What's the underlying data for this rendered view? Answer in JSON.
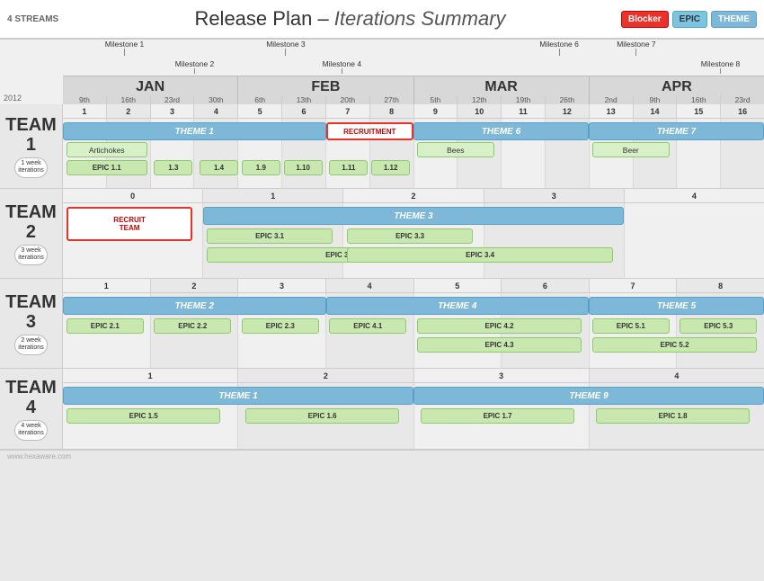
{
  "header": {
    "streams": "4 STREAMS",
    "title": "Release Plan",
    "subtitle": "Iterations Summary",
    "badges": {
      "blocker": "Blocker",
      "epic": "EPIC",
      "theme": "THEME"
    }
  },
  "year": "2012",
  "milestones_top": [
    {
      "label": "Milestone 1",
      "left_pct": 9
    },
    {
      "label": "Milestone 3",
      "left_pct": 31
    },
    {
      "label": "Milestone 6",
      "left_pct": 70
    },
    {
      "label": "Milestone 7",
      "left_pct": 79
    }
  ],
  "milestones_mid": [
    {
      "label": "Milestone 2",
      "left_pct": 18
    },
    {
      "label": "Milestone 4",
      "left_pct": 39
    },
    {
      "label": "Milestone 8",
      "left_pct": 92
    }
  ],
  "months": [
    {
      "name": "JAN",
      "days": [
        "9th",
        "16th",
        "23rd",
        "30th"
      ],
      "width_pct": 25
    },
    {
      "name": "FEB",
      "days": [
        "6th",
        "13th",
        "20th",
        "27th"
      ],
      "width_pct": 25
    },
    {
      "name": "MAR",
      "days": [
        "5th",
        "12th",
        "19th",
        "26th"
      ],
      "width_pct": 25
    },
    {
      "name": "APR",
      "days": [
        "2nd",
        "9th",
        "16th",
        "23rd"
      ],
      "width_pct": 25
    }
  ],
  "teams": [
    {
      "name": "TEAM\n1",
      "iterations": "1 week\niterations",
      "iter_count": 16,
      "iter_start": 1,
      "themes": [
        {
          "label": "THEME 1",
          "start": 1,
          "end": 6,
          "color": "#7db8d8"
        },
        {
          "label": "THEME 6",
          "start": 9,
          "end": 12,
          "color": "#7db8d8"
        },
        {
          "label": "THEME 7",
          "start": 13,
          "end": 16,
          "color": "#7db8d8"
        }
      ],
      "epics": [
        {
          "label": "EPIC 1.1",
          "start": 1,
          "end": 2
        },
        {
          "label": "1.3",
          "start": 3,
          "end": 3
        },
        {
          "label": "1.4",
          "start": 4,
          "end": 4
        },
        {
          "label": "1.9",
          "start": 4,
          "end": 4,
          "row": 2
        },
        {
          "label": "1.10",
          "start": 5,
          "end": 5
        },
        {
          "label": "1.11",
          "start": 7,
          "end": 7
        },
        {
          "label": "1.12",
          "start": 8,
          "end": 8
        }
      ],
      "blockers": [
        {
          "label": "RECRUITMENT",
          "start": 7,
          "end": 8
        }
      ],
      "features": [
        {
          "label": "Artichokes",
          "start": 1,
          "end": 2
        },
        {
          "label": "Bees",
          "start": 9,
          "end": 10
        },
        {
          "label": "Beer",
          "start": 13,
          "end": 14
        }
      ]
    },
    {
      "name": "TEAM\n2",
      "iterations": "3 week\niterations",
      "iter_count": 5,
      "iter_start": 0,
      "themes": [
        {
          "label": "THEME 3",
          "start": 1,
          "end": 3,
          "color": "#7db8d8"
        }
      ],
      "epics": [
        {
          "label": "EPIC 3.1",
          "start": 1,
          "end": 1
        },
        {
          "label": "EPIC 3.2",
          "start": 1,
          "end": 2,
          "row": 2
        },
        {
          "label": "EPIC 3.3",
          "start": 2,
          "end": 2
        },
        {
          "label": "EPIC 3.4",
          "start": 2,
          "end": 3,
          "row": 2
        }
      ],
      "blockers": [
        {
          "label": "RECRUIT\nTEAM",
          "start": 0,
          "end": 0
        }
      ]
    },
    {
      "name": "TEAM\n3",
      "iterations": "2 week\niterations",
      "iter_count": 8,
      "iter_start": 1,
      "themes": [
        {
          "label": "THEME 2",
          "start": 1,
          "end": 3,
          "color": "#7db8d8"
        },
        {
          "label": "THEME 4",
          "start": 4,
          "end": 6,
          "color": "#7db8d8"
        },
        {
          "label": "THEME 5",
          "start": 7,
          "end": 8,
          "color": "#7db8d8"
        }
      ],
      "epics": [
        {
          "label": "EPIC 2.1",
          "start": 1,
          "end": 1
        },
        {
          "label": "EPIC 2.2",
          "start": 2,
          "end": 2
        },
        {
          "label": "EPIC 2.3",
          "start": 3,
          "end": 3
        },
        {
          "label": "EPIC 4.1",
          "start": 4,
          "end": 4
        },
        {
          "label": "EPIC 4.2",
          "start": 5,
          "end": 6
        },
        {
          "label": "EPIC 4.3",
          "start": 5,
          "end": 6,
          "row": 2
        },
        {
          "label": "EPIC 5.1",
          "start": 7,
          "end": 7
        },
        {
          "label": "EPIC 5.2",
          "start": 7,
          "end": 8,
          "row": 2
        },
        {
          "label": "EPIC 5.3",
          "start": 8,
          "end": 8
        }
      ]
    },
    {
      "name": "TEAM\n4",
      "iterations": "4 week\niterations",
      "iter_count": 4,
      "iter_start": 1,
      "themes": [
        {
          "label": "THEME 1",
          "start": 1,
          "end": 2,
          "color": "#7db8d8"
        },
        {
          "label": "THEME 9",
          "start": 3,
          "end": 4,
          "color": "#7db8d8"
        }
      ],
      "epics": [
        {
          "label": "EPIC 1.5",
          "start": 1,
          "end": 1
        },
        {
          "label": "EPIC 1.6",
          "start": 2,
          "end": 2
        },
        {
          "label": "EPIC 1.7",
          "start": 3,
          "end": 3
        },
        {
          "label": "EPIC 1.8",
          "start": 4,
          "end": 4
        }
      ]
    }
  ],
  "footer": "www.hexaware.com"
}
